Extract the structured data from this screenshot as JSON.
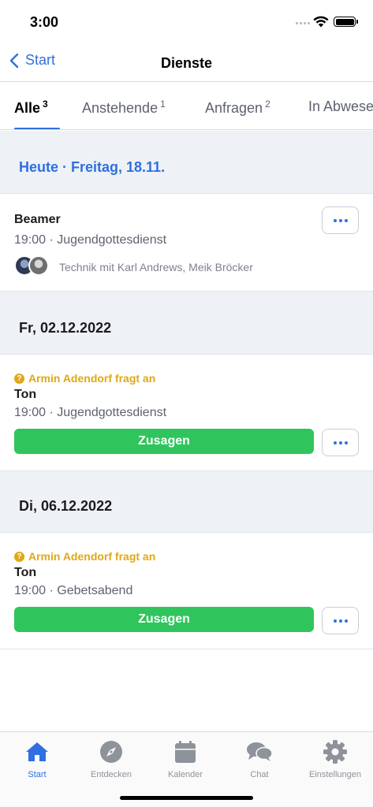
{
  "status_bar": {
    "time": "3:00"
  },
  "nav": {
    "back_label": "Start",
    "title": "Dienste"
  },
  "tabs": [
    {
      "label": "Alle",
      "count": "3"
    },
    {
      "label": "Anstehende",
      "count": "1"
    },
    {
      "label": "Anfragen",
      "count": "2"
    },
    {
      "label": "In Abwesenheit",
      "count": ""
    }
  ],
  "sections": [
    {
      "date": "Heute · Freitag, 18.11.",
      "item": {
        "title": "Beamer",
        "subtitle": "19:00 · Jugendgottesdienst",
        "team": "Technik mit Karl Andrews, Meik Bröcker"
      }
    },
    {
      "date": "Fr, 02.12.2022",
      "item": {
        "requester": "Armin Adendorf fragt an",
        "title": "Ton",
        "subtitle": "19:00 · Jugendgottesdienst",
        "accept_label": "Zusagen"
      }
    },
    {
      "date": "Di, 06.12.2022",
      "item": {
        "requester": "Armin Adendorf fragt an",
        "title": "Ton",
        "subtitle": "19:00 · Gebetsabend",
        "accept_label": "Zusagen"
      }
    }
  ],
  "tab_bar": [
    {
      "label": "Start",
      "icon": "home-icon"
    },
    {
      "label": "Entdecken",
      "icon": "compass-icon"
    },
    {
      "label": "Kalender",
      "icon": "calendar-icon"
    },
    {
      "label": "Chat",
      "icon": "chat-icon"
    },
    {
      "label": "Einstellungen",
      "icon": "gear-icon"
    }
  ],
  "colors": {
    "accent": "#2f6fe0",
    "accept": "#2fc55c",
    "request": "#e0a814",
    "section_bg": "#eef1f6"
  }
}
